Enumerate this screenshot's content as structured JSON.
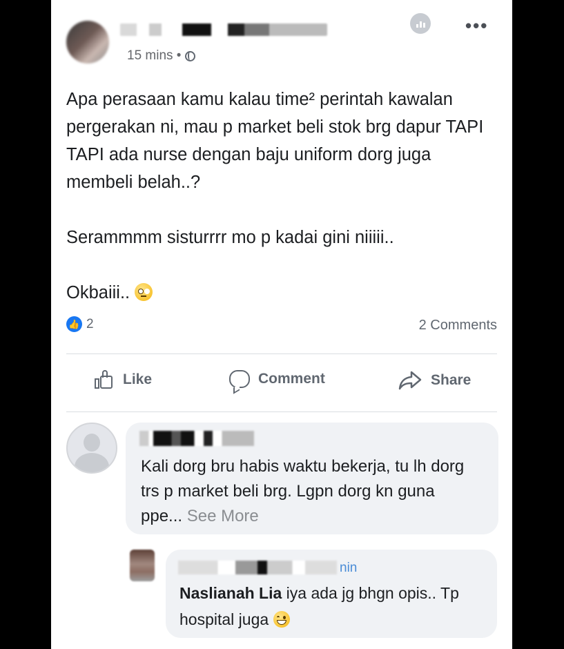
{
  "post": {
    "timestamp": "15 mins •",
    "paragraphs": [
      "Apa perasaan kamu kalau time² perintah kawalan pergerakan ni, mau p market beli stok brg dapur TAPI TAPI ada nurse dengan baju uniform dorg juga membeli belah..?",
      "Serammmm sisturrrr mo p kadai gini niiiii..",
      "Okbaiii.."
    ],
    "emoji": "rolling-eyes-emoji",
    "reaction_count": "2",
    "comment_count": "2 Comments"
  },
  "actions": {
    "like_label": "Like",
    "comment_label": "Comment",
    "share_label": "Share"
  },
  "comments": [
    {
      "text": "Kali dorg bru habis waktu bekerja, tu lh dorg trs p market beli brg. Lgpn dorg kn guna ppe...",
      "see_more": "See More"
    },
    {
      "header_visible_fragment": "nin",
      "author": "Naslianah Lia",
      "text": "iya ada jg bhgn opis.. Tp hospital juga",
      "emoji": "grinning-sweat-emoji"
    }
  ],
  "colors": {
    "background": "#000000",
    "card": "#ffffff",
    "text": "#1c1e21",
    "secondary": "#606770",
    "like_blue": "#1877f2",
    "bubble": "#f0f2f5"
  }
}
